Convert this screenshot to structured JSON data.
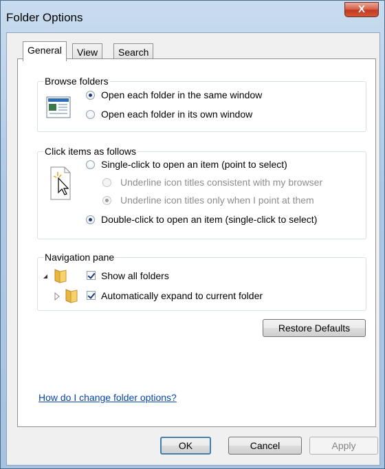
{
  "window": {
    "title": "Folder Options",
    "close_label": "X"
  },
  "tabs": [
    {
      "label": "General",
      "active": true
    },
    {
      "label": "View",
      "active": false
    },
    {
      "label": "Search",
      "active": false
    }
  ],
  "browse_folders": {
    "title": "Browse folders",
    "options": [
      {
        "label": "Open each folder in the same window",
        "selected": true
      },
      {
        "label": "Open each folder in its own window",
        "selected": false
      }
    ]
  },
  "click_items": {
    "title": "Click items as follows",
    "options": [
      {
        "label": "Single-click to open an item (point to select)",
        "selected": false,
        "enabled": true
      },
      {
        "label": "Underline icon titles consistent with my browser",
        "selected": false,
        "enabled": false
      },
      {
        "label": "Underline icon titles only when I point at them",
        "selected": true,
        "enabled": false
      },
      {
        "label": "Double-click to open an item (single-click to select)",
        "selected": true,
        "enabled": true
      }
    ]
  },
  "navigation_pane": {
    "title": "Navigation pane",
    "options": [
      {
        "label": "Show all folders",
        "checked": true
      },
      {
        "label": "Automatically expand to current folder",
        "checked": true
      }
    ]
  },
  "restore_defaults_label": "Restore Defaults",
  "help_link": "How do I change folder options?",
  "footer": {
    "ok_label": "OK",
    "cancel_label": "Cancel",
    "apply_label": "Apply"
  },
  "colors": {
    "accent": "#3c7fb1",
    "link": "#0645ad",
    "close": "#c03a22"
  }
}
